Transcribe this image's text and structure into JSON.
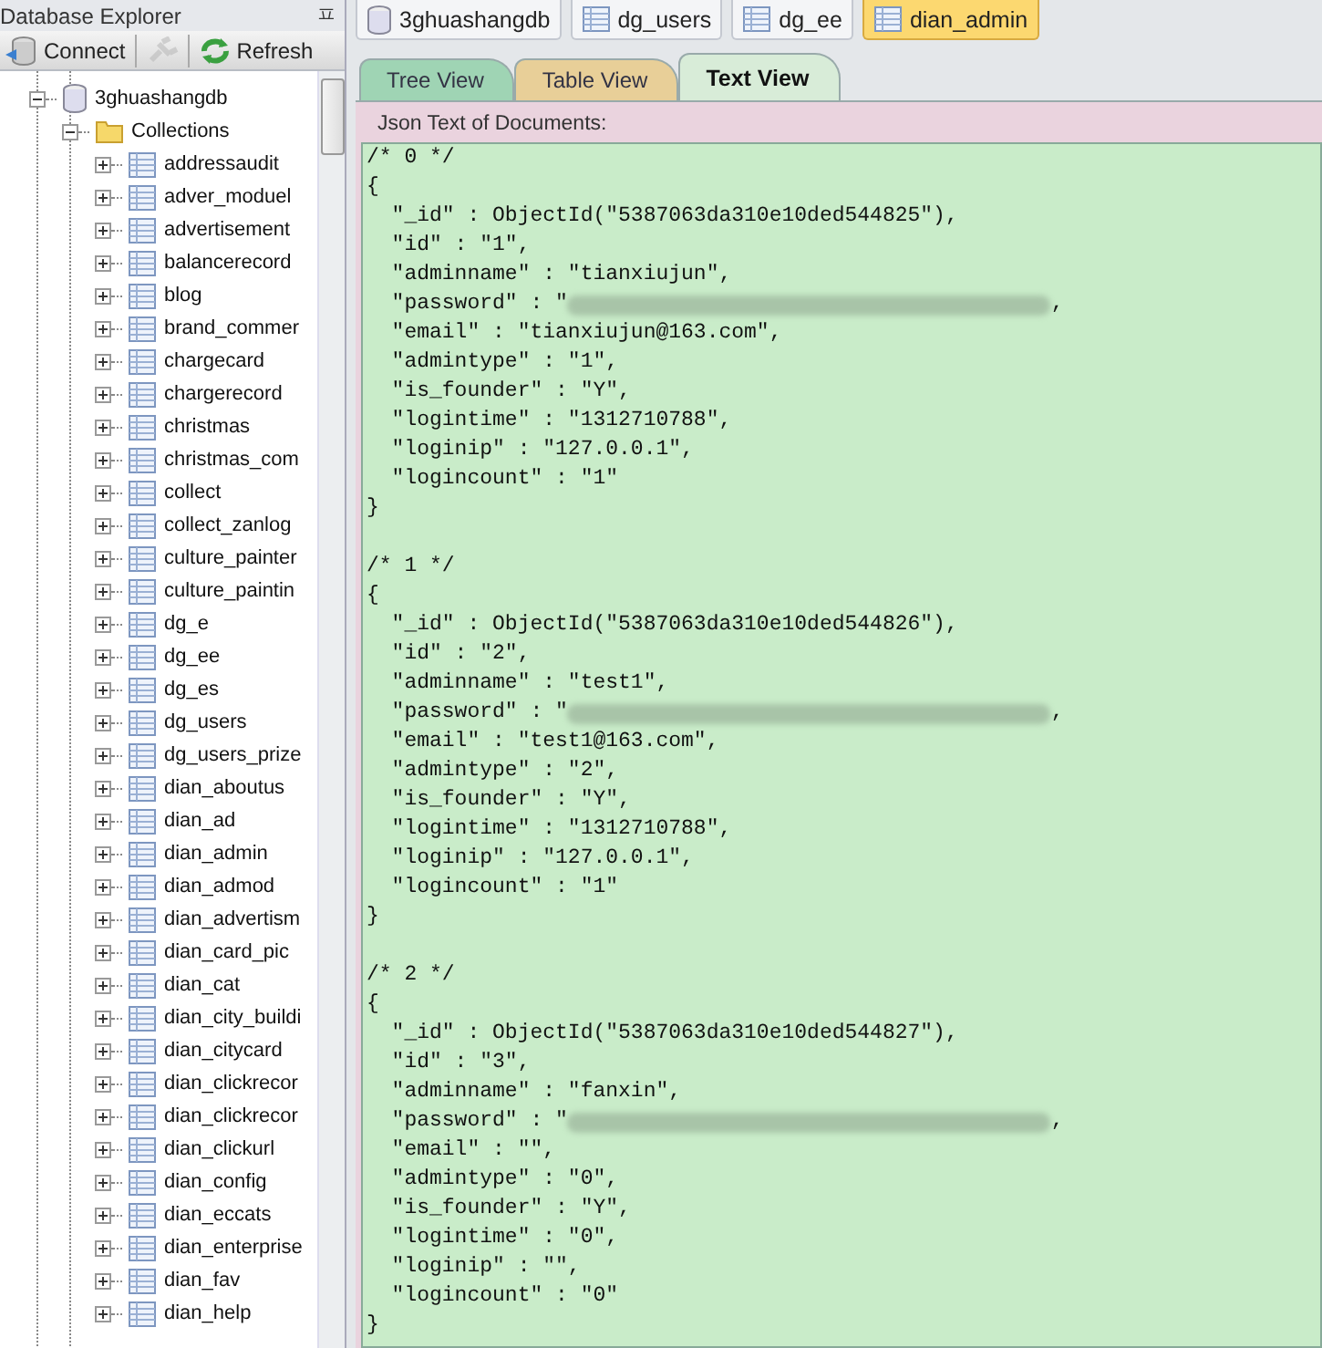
{
  "explorer": {
    "title": "Database Explorer",
    "pin": "ㅍ",
    "toolbar": [
      {
        "kind": "connect",
        "label": "Connect",
        "disabled": false
      },
      {
        "kind": "disconnect",
        "disabled": true
      },
      {
        "kind": "refresh",
        "label": "Refresh",
        "disabled": false
      }
    ],
    "tree": [
      {
        "kind": "database",
        "label": "3ghuashangdb",
        "expanded": true,
        "children": [
          {
            "kind": "folder",
            "label": "Collections",
            "expanded": true,
            "children": [
              {
                "kind": "collection",
                "label": "addressaudit",
                "expanded": false
              },
              {
                "kind": "collection",
                "label": "adver_moduel",
                "expanded": false
              },
              {
                "kind": "collection",
                "label": "advertisement",
                "expanded": false
              },
              {
                "kind": "collection",
                "label": "balancerecord",
                "expanded": false
              },
              {
                "kind": "collection",
                "label": "blog",
                "expanded": false
              },
              {
                "kind": "collection",
                "label": "brand_commer",
                "expanded": false
              },
              {
                "kind": "collection",
                "label": "chargecard",
                "expanded": false
              },
              {
                "kind": "collection",
                "label": "chargerecord",
                "expanded": false
              },
              {
                "kind": "collection",
                "label": "christmas",
                "expanded": false
              },
              {
                "kind": "collection",
                "label": "christmas_com",
                "expanded": false
              },
              {
                "kind": "collection",
                "label": "collect",
                "expanded": false
              },
              {
                "kind": "collection",
                "label": "collect_zanlog",
                "expanded": false
              },
              {
                "kind": "collection",
                "label": "culture_painter",
                "expanded": false
              },
              {
                "kind": "collection",
                "label": "culture_paintin",
                "expanded": false
              },
              {
                "kind": "collection",
                "label": "dg_e",
                "expanded": false
              },
              {
                "kind": "collection",
                "label": "dg_ee",
                "expanded": false
              },
              {
                "kind": "collection",
                "label": "dg_es",
                "expanded": false
              },
              {
                "kind": "collection",
                "label": "dg_users",
                "expanded": false
              },
              {
                "kind": "collection",
                "label": "dg_users_prize",
                "expanded": false
              },
              {
                "kind": "collection",
                "label": "dian_aboutus",
                "expanded": false
              },
              {
                "kind": "collection",
                "label": "dian_ad",
                "expanded": false
              },
              {
                "kind": "collection",
                "label": "dian_admin",
                "expanded": false
              },
              {
                "kind": "collection",
                "label": "dian_admod",
                "expanded": false
              },
              {
                "kind": "collection",
                "label": "dian_advertism",
                "expanded": false
              },
              {
                "kind": "collection",
                "label": "dian_card_pic",
                "expanded": false
              },
              {
                "kind": "collection",
                "label": "dian_cat",
                "expanded": false
              },
              {
                "kind": "collection",
                "label": "dian_city_buildi",
                "expanded": false
              },
              {
                "kind": "collection",
                "label": "dian_citycard",
                "expanded": false
              },
              {
                "kind": "collection",
                "label": "dian_clickrecor",
                "expanded": false
              },
              {
                "kind": "collection",
                "label": "dian_clickrecor",
                "expanded": false
              },
              {
                "kind": "collection",
                "label": "dian_clickurl",
                "expanded": false
              },
              {
                "kind": "collection",
                "label": "dian_config",
                "expanded": false
              },
              {
                "kind": "collection",
                "label": "dian_eccats",
                "expanded": false
              },
              {
                "kind": "collection",
                "label": "dian_enterprise",
                "expanded": false
              },
              {
                "kind": "collection",
                "label": "dian_fav",
                "expanded": false
              },
              {
                "kind": "collection",
                "label": "dian_help",
                "expanded": false
              }
            ]
          }
        ]
      }
    ]
  },
  "doc_tabs": [
    {
      "kind": "database",
      "label": "3ghuashangdb",
      "selected": false
    },
    {
      "kind": "collection",
      "label": "dg_users",
      "selected": false
    },
    {
      "kind": "collection",
      "label": "dg_ee",
      "selected": false
    },
    {
      "kind": "collection",
      "label": "dian_admin",
      "selected": true
    }
  ],
  "view_tabs": [
    {
      "label": "Tree View",
      "color": "#9fd4b4",
      "selected": false
    },
    {
      "label": "Table View",
      "color": "#e8cf98",
      "selected": false
    },
    {
      "label": "Text View",
      "color": "#d8ecd8",
      "selected": true
    }
  ],
  "text_view": {
    "label": "Json Text of Documents:",
    "lines": [
      {
        "kind": "text",
        "text": "/* 0 */"
      },
      {
        "kind": "text",
        "text": "{"
      },
      {
        "kind": "text",
        "text": "  \"_id\" : ObjectId(\"5387063da310e10ded544825\"),"
      },
      {
        "kind": "text",
        "text": "  \"id\" : \"1\","
      },
      {
        "kind": "text",
        "text": "  \"adminname\" : \"tianxiujun\","
      },
      {
        "kind": "redacted",
        "text": "  \"password\" : \"",
        "after": ","
      },
      {
        "kind": "text",
        "text": "  \"email\" : \"tianxiujun@163.com\","
      },
      {
        "kind": "text",
        "text": "  \"admintype\" : \"1\","
      },
      {
        "kind": "text",
        "text": "  \"is_founder\" : \"Y\","
      },
      {
        "kind": "text",
        "text": "  \"logintime\" : \"1312710788\","
      },
      {
        "kind": "text",
        "text": "  \"loginip\" : \"127.0.0.1\","
      },
      {
        "kind": "text",
        "text": "  \"logincount\" : \"1\""
      },
      {
        "kind": "text",
        "text": "}"
      },
      {
        "kind": "blank"
      },
      {
        "kind": "text",
        "text": "/* 1 */"
      },
      {
        "kind": "text",
        "text": "{"
      },
      {
        "kind": "text",
        "text": "  \"_id\" : ObjectId(\"5387063da310e10ded544826\"),"
      },
      {
        "kind": "text",
        "text": "  \"id\" : \"2\","
      },
      {
        "kind": "text",
        "text": "  \"adminname\" : \"test1\","
      },
      {
        "kind": "redacted",
        "text": "  \"password\" : \"",
        "after": ","
      },
      {
        "kind": "text",
        "text": "  \"email\" : \"test1@163.com\","
      },
      {
        "kind": "text",
        "text": "  \"admintype\" : \"2\","
      },
      {
        "kind": "text",
        "text": "  \"is_founder\" : \"Y\","
      },
      {
        "kind": "text",
        "text": "  \"logintime\" : \"1312710788\","
      },
      {
        "kind": "text",
        "text": "  \"loginip\" : \"127.0.0.1\","
      },
      {
        "kind": "text",
        "text": "  \"logincount\" : \"1\""
      },
      {
        "kind": "text",
        "text": "}"
      },
      {
        "kind": "blank"
      },
      {
        "kind": "text",
        "text": "/* 2 */"
      },
      {
        "kind": "text",
        "text": "{"
      },
      {
        "kind": "text",
        "text": "  \"_id\" : ObjectId(\"5387063da310e10ded544827\"),"
      },
      {
        "kind": "text",
        "text": "  \"id\" : \"3\","
      },
      {
        "kind": "text",
        "text": "  \"adminname\" : \"fanxin\","
      },
      {
        "kind": "redacted",
        "text": "  \"password\" : \"",
        "after": ","
      },
      {
        "kind": "text",
        "text": "  \"email\" : \"\","
      },
      {
        "kind": "text",
        "text": "  \"admintype\" : \"0\","
      },
      {
        "kind": "text",
        "text": "  \"is_founder\" : \"Y\","
      },
      {
        "kind": "text",
        "text": "  \"logintime\" : \"0\","
      },
      {
        "kind": "text",
        "text": "  \"loginip\" : \"\","
      },
      {
        "kind": "text",
        "text": "  \"logincount\" : \"0\""
      },
      {
        "kind": "text",
        "text": "}"
      }
    ]
  }
}
